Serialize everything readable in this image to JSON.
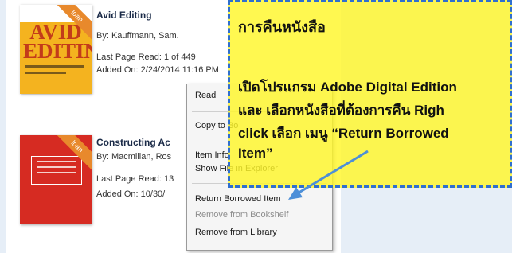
{
  "books": [
    {
      "title": "Avid Editing",
      "author": "By: Kauffmann, Sam.",
      "last_page": "Last Page Read: 1 of 449",
      "added": "Added On: 2/24/2014 11:16 PM",
      "cover_title": "AVID EDITING",
      "badge": "loan"
    },
    {
      "title": "Constructing Ac",
      "author": "By: Macmillan, Ros",
      "last_page": "Last Page Read: 13",
      "added": "Added On: 10/30/",
      "badge": "loan"
    }
  ],
  "context_menu": {
    "read": "Read",
    "copy_to": "Copy to Bo",
    "item_info": "Item Info",
    "show_file": "Show File in Explorer",
    "return_borrowed": "Return Borrowed Item",
    "remove_bookshelf": "Remove from Bookshelf",
    "remove_library": "Remove from Library"
  },
  "callout": {
    "title": "การคืนหนังสือ",
    "line1": "เปิดโปรแกรม Adobe Digital Edition",
    "line2": "และ เลือกหนังสือที่ต้องการคืน Righ",
    "line3": "click  เลือก เมนู “Return Borrowed",
    "line4": "Item”",
    "accent_color": "#2f6fcf",
    "background_color": "#fff729"
  }
}
